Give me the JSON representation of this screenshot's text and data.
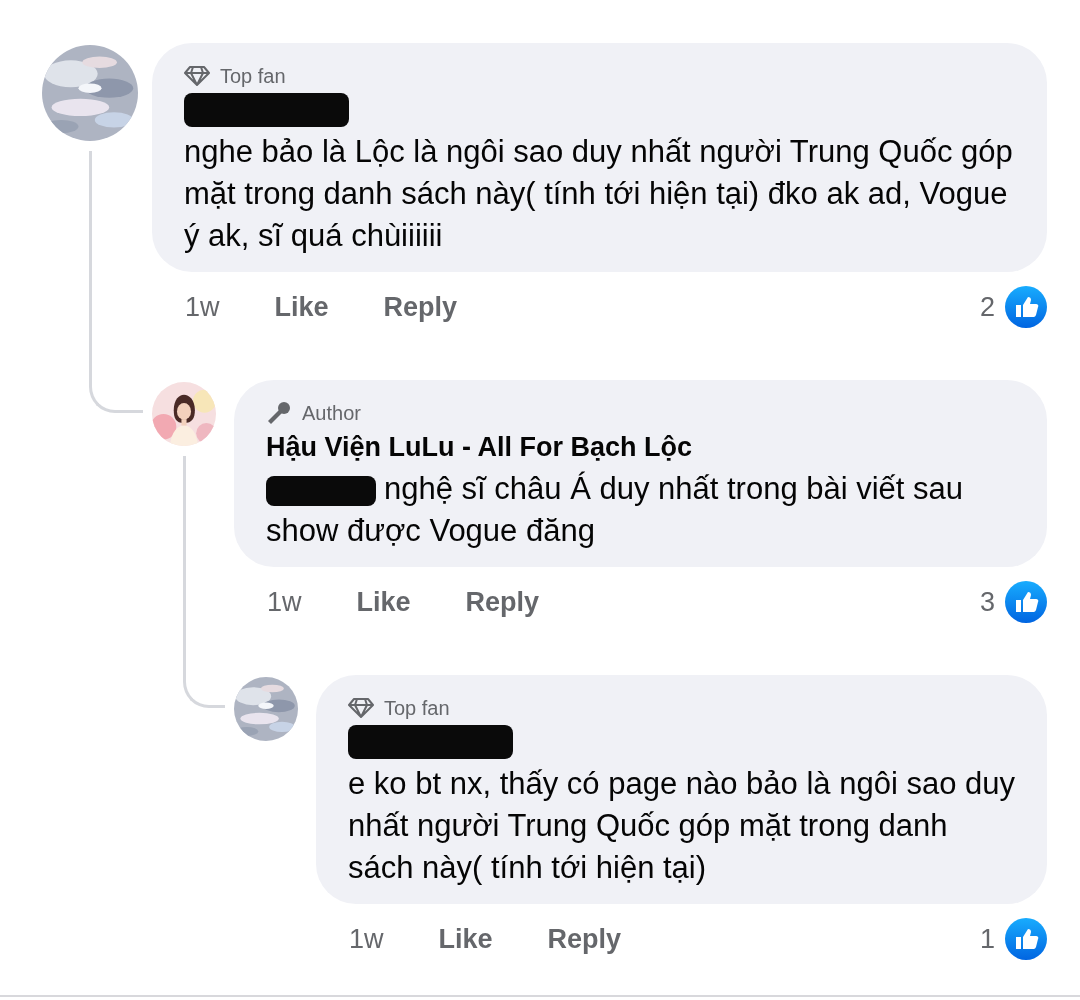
{
  "comments": [
    {
      "avatar": {
        "kind": "picture"
      },
      "badge": {
        "kind": "diamond",
        "label": "Top fan"
      },
      "author": {
        "redacted": true
      },
      "text": "nghe bảo là Lộc là ngôi sao duy nhất người Trung Quốc góp mặt trong danh sách này( tính tới hiện tại) đko ak ad, Vogue ý ak, sĩ quá chùiiiiii",
      "time": "1w",
      "actions": [
        "Like",
        "Reply"
      ],
      "reactions": "2",
      "children": [
        {
          "avatar": {
            "kind": "picture"
          },
          "badge": {
            "kind": "microphone",
            "label": "Author"
          },
          "author": {
            "redacted": false,
            "name": "Hậu Viện LuLu - All For Bạch Lộc"
          },
          "mention_redacted": true,
          "text": "nghệ sĩ châu Á duy nhất trong bài viết sau show được Vogue đăng",
          "time": "1w",
          "actions": [
            "Like",
            "Reply"
          ],
          "reactions": "3",
          "children": [
            {
              "avatar": {
                "kind": "picture"
              },
              "badge": {
                "kind": "diamond",
                "label": "Top fan"
              },
              "author": {
                "redacted": true
              },
              "text": "e ko bt nx, thấy có page nào bảo là ngôi sao duy nhất người Trung Quốc góp mặt trong danh sách này( tính tới hiện tại)",
              "time": "1w",
              "actions": [
                "Like",
                "Reply"
              ],
              "reactions": "1"
            }
          ]
        }
      ]
    }
  ]
}
